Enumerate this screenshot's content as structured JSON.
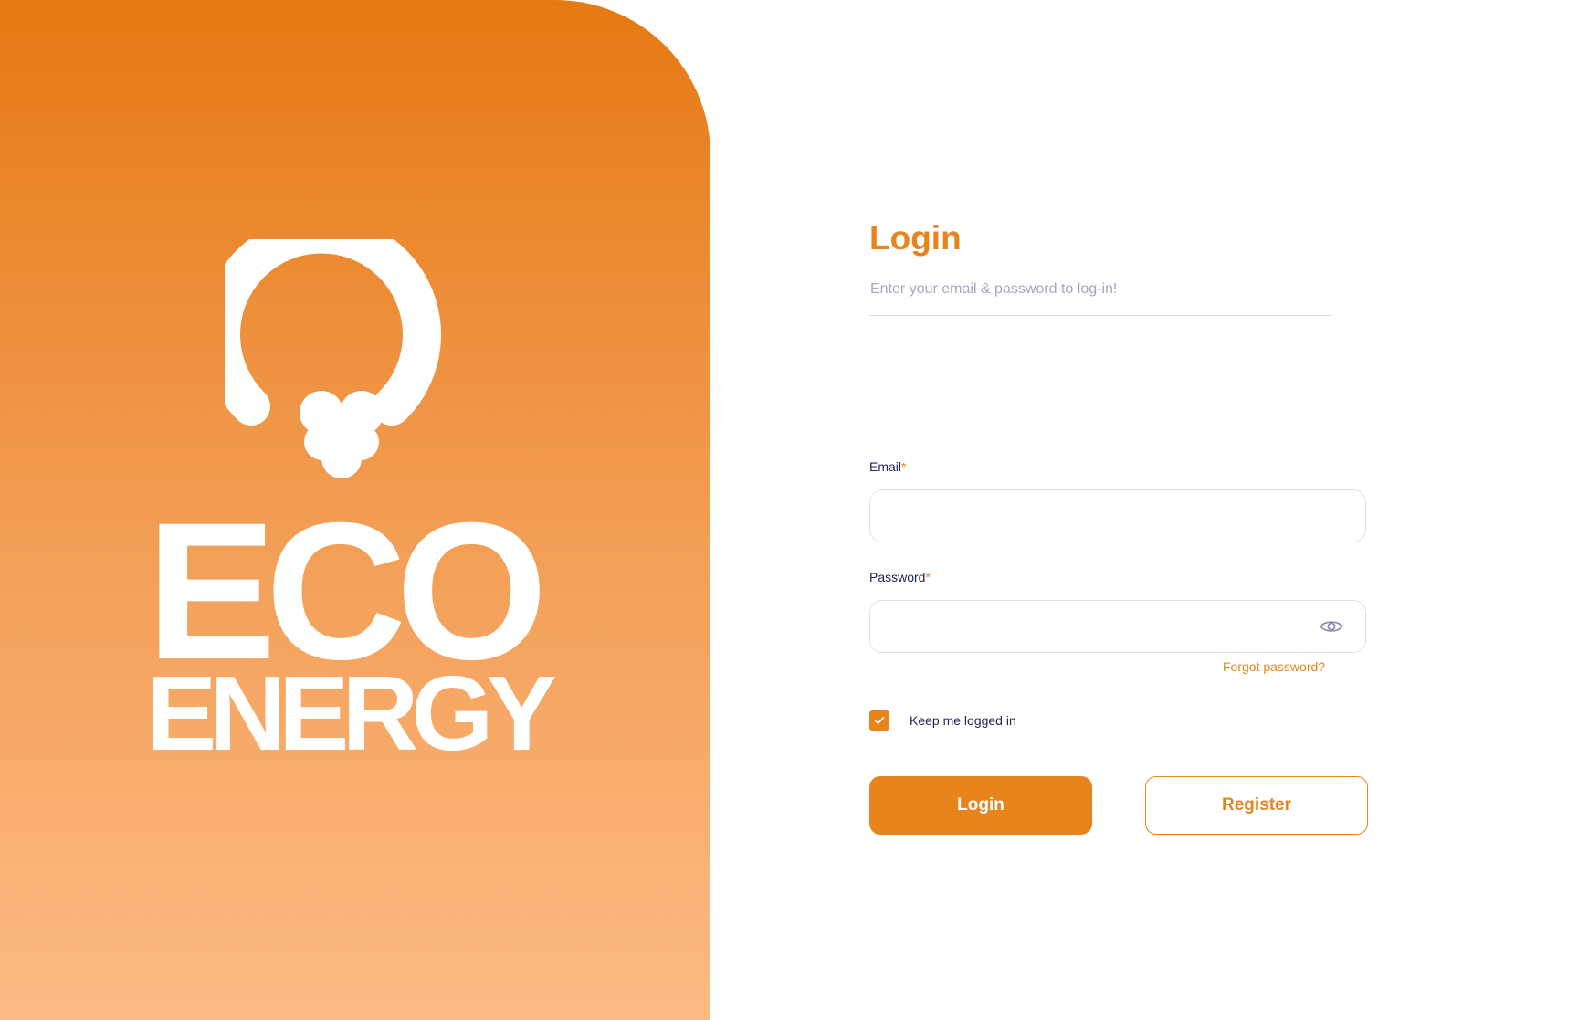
{
  "brand": {
    "logo_line1": "ECO",
    "logo_line2": "ENERGY",
    "logo_icon": "lightbulb-icon"
  },
  "login_form": {
    "title": "Login",
    "subtitle": "Enter your email & password to log-in!",
    "email_label": "Email",
    "password_label": "Password",
    "required_marker": "*",
    "email_value": "",
    "password_value": "",
    "password_toggle_icon": "eye-icon",
    "forgot_password": "Forgot password?",
    "keep_logged_in_label": "Keep me logged in",
    "keep_logged_in_checked": true,
    "login_button": "Login",
    "register_button": "Register"
  },
  "colors": {
    "accent": "#e8841c",
    "gradient_top": "#e67912",
    "gradient_bottom": "#fdbb84",
    "label_text": "#1f2557",
    "muted_text": "#a4a6c6"
  }
}
